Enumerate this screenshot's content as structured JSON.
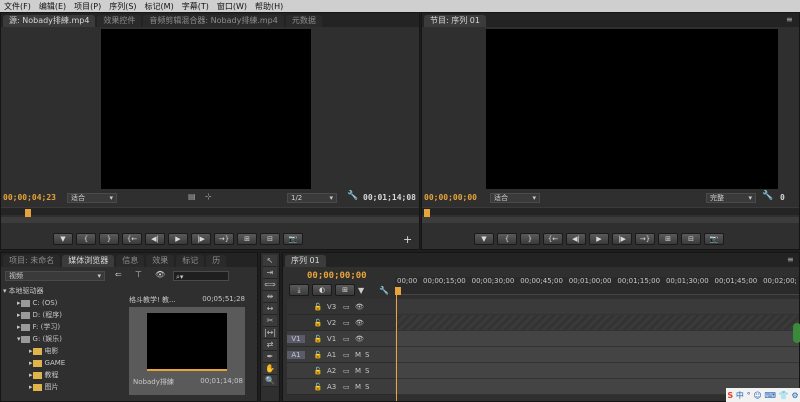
{
  "menu": [
    "文件(F)",
    "编辑(E)",
    "项目(P)",
    "序列(S)",
    "标记(M)",
    "字幕(T)",
    "窗口(W)",
    "帮助(H)"
  ],
  "source_panel": {
    "tabs": [
      "源: Nobady排練.mp4",
      "效果控件",
      "音频剪辑混合器: Nobady排練.mp4",
      "元数据"
    ],
    "timecode": "00;00;04;23",
    "fit": "适合",
    "scale": "1/2",
    "duration": "00;01;14;08"
  },
  "program_panel": {
    "tab": "节目: 序列 01",
    "timecode": "00;00;00;00",
    "fit": "适合",
    "quality": "完整",
    "duration": "00;01;14;08"
  },
  "project_panel": {
    "tabs": [
      "项目: 未命名",
      "媒体浏览器",
      "信息",
      "效果",
      "标记",
      "历"
    ],
    "view_select": "视频",
    "tree_root": "本地驱动器",
    "drives": [
      "C: (OS)",
      "D: (程序)",
      "F: (学习)",
      "G: (娱乐)"
    ],
    "folders": [
      "电影",
      "GAME",
      "教程",
      "图片"
    ],
    "clip_title": "格斗教学! 教...",
    "clip_duration_top": "00;05;51;28",
    "clip_name": "Nobady排練",
    "clip_duration": "00;01;14;08"
  },
  "timeline": {
    "tab": "序列 01",
    "timecode": "00;00;00;00",
    "ruler": [
      "00;00",
      "00;00;15;00",
      "00;00;30;00",
      "00;00;45;00",
      "00;01;00;00",
      "00;01;15;00",
      "00;01;30;00",
      "00;01;45;00",
      "00;02;00;"
    ],
    "tracks": [
      {
        "src": "",
        "name": "V3"
      },
      {
        "src": "",
        "name": "V2"
      },
      {
        "src": "V1",
        "name": "V1"
      },
      {
        "src": "A1",
        "name": "A1",
        "m": "M",
        "s": "S"
      },
      {
        "src": "",
        "name": "A2",
        "m": "M",
        "s": "S"
      },
      {
        "src": "",
        "name": "A3",
        "m": "M",
        "s": "S"
      }
    ]
  },
  "ime": [
    "S",
    "中",
    "°",
    "☺",
    "⌨",
    "👕",
    "⚙"
  ],
  "colors": {
    "accent": "#e7a43a",
    "panel": "#2f2f2f",
    "bg": "#1e1e1e"
  }
}
